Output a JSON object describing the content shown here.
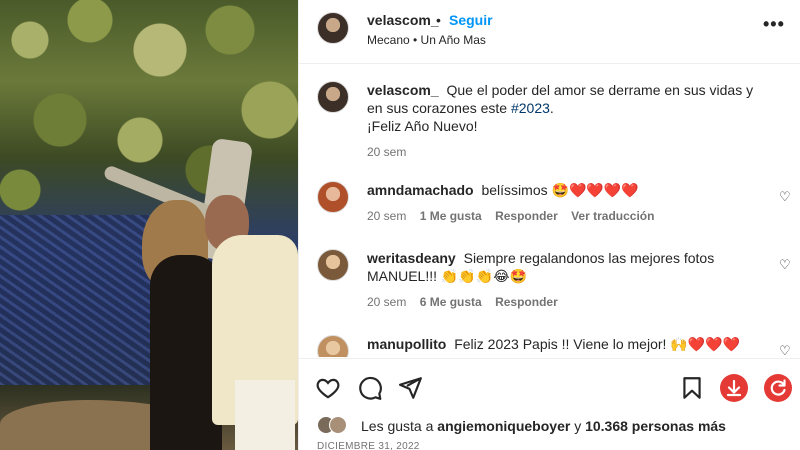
{
  "post": {
    "username": "velascom_",
    "separator": "•",
    "follow_label": "Seguir",
    "song": "Mecano • Un Año Mas",
    "more_icon": "more-horizontal-icon"
  },
  "caption": {
    "username": "velascom_",
    "text_before": "Que el poder del amor se derrame en sus vidas y en sus corazones este",
    "hashtag": "#2023",
    "text_after": ".",
    "line2": "¡Feliz Año Nuevo!",
    "time": "20 sem"
  },
  "comments": [
    {
      "username": "amndamachado",
      "text": "belíssimos",
      "emojis": "🤩",
      "hearts": "❤️❤️❤️❤️",
      "time": "20 sem",
      "likes": "1 Me gusta",
      "reply": "Responder",
      "translate": "Ver traducción"
    },
    {
      "username": "weritasdeany",
      "text": "Siempre regalandonos las mejores fotos MANUEL!!!",
      "emojis": "👏👏👏😂🤩",
      "time": "20 sem",
      "likes": "6 Me gusta",
      "reply": "Responder"
    },
    {
      "username": "manupollito",
      "text": "Feliz 2023 Papis !! Viene lo mejor!",
      "emojis": "🙌",
      "hearts": "❤️❤️❤️"
    }
  ],
  "likes": {
    "prefix": "Les gusta a",
    "user": "angiemoniqueboyer",
    "middle": "y",
    "count": "10.368 personas más"
  },
  "date": "DICIEMBRE 31, 2022",
  "colors": {
    "accent": "#0095f6",
    "download_red": "#e53935",
    "heart_red": "#ed1c24",
    "hashtag": "#00376b"
  }
}
